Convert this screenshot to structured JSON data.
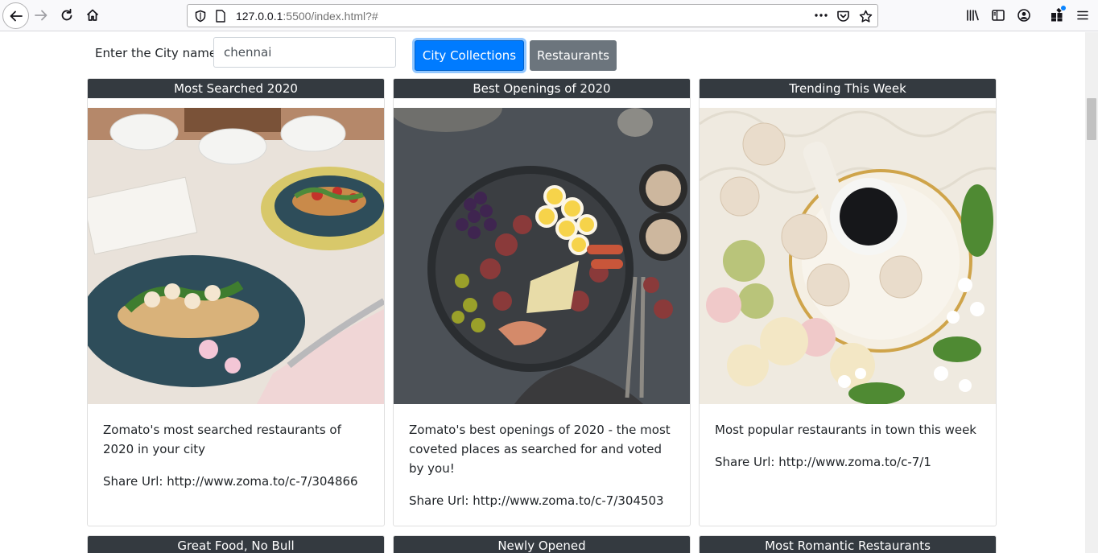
{
  "browser": {
    "url_host": "127.0.0.1",
    "url_path": ":5500/index.html?#",
    "icons": [
      "back-icon",
      "forward-icon",
      "reload-icon",
      "home-icon",
      "shield-icon",
      "page-icon",
      "more-icon",
      "pocket-icon",
      "star-icon",
      "library-icon",
      "sidebar-icon",
      "account-icon",
      "extensions-icon",
      "menu-icon"
    ]
  },
  "search": {
    "label": "Enter the City name:",
    "value": "chennai"
  },
  "buttons": {
    "collections": "City Collections",
    "restaurants": "Restaurants"
  },
  "colors": {
    "primary": "#007bff",
    "secondary": "#6c757d",
    "card_header": "#343a40"
  },
  "cards": [
    {
      "title": "Most Searched 2020",
      "description": "Zomato's most searched restaurants of 2020 in your city",
      "share": "Share Url: http://www.zoma.to/c-7/304866"
    },
    {
      "title": "Best Openings of 2020",
      "description": "Zomato's best openings of 2020 - the most coveted places as searched for and voted by you!",
      "share": "Share Url: http://www.zoma.to/c-7/304503"
    },
    {
      "title": "Trending This Week",
      "description": "Most popular restaurants in town this week",
      "share": "Share Url: http://www.zoma.to/c-7/1"
    },
    {
      "title": "Great Food, No Bull"
    },
    {
      "title": "Newly Opened"
    },
    {
      "title": "Most Romantic Restaurants"
    }
  ]
}
